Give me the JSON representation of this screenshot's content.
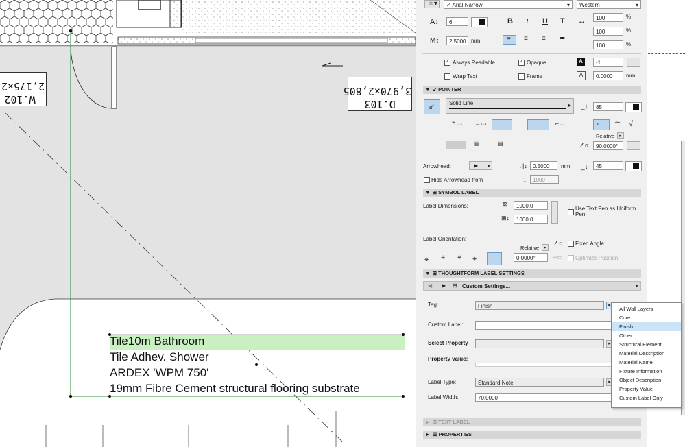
{
  "note": {
    "lines": [
      "Tile10m Bathroom",
      "Tile Adhev. Shower",
      "ARDEX 'WPM 750'",
      "19mm Fibre Cement structural flooring substrate"
    ],
    "highlight_color": "#c8f0c0"
  },
  "tags": {
    "window_tag": "W.102",
    "window_size": "2,175×2,",
    "door_tag": "D.103",
    "door_size": "3,970×2,805"
  },
  "panel": {
    "font_name": "Arial Narrow",
    "script": "Western",
    "text_size": "6",
    "spacing": "2.5000",
    "spacing_unit": "mm",
    "width_factor": "100",
    "char_spacing": "100",
    "slant": "100",
    "pct": "%",
    "always_readable": "Always Readable",
    "opaque": "Opaque",
    "wrap_text": "Wrap Text",
    "frame": "Frame",
    "bg_pen": "-1",
    "offset": "0.0000",
    "offset_unit": "mm",
    "pointer_section": "POINTER",
    "line_type": "Solid Line",
    "pointer_pen": "85",
    "relative": "Relative",
    "angle": "90.0000°",
    "arrowhead_label": "Arrowhead:",
    "arrow_size": "0.5000",
    "arrow_unit": "mm",
    "arrow_pen": "45",
    "hide_arrowhead": "Hide Arrowhead from",
    "scale_prefix": "1:",
    "scale_value": "1000",
    "symbol_section": "SYMBOL LABEL",
    "label_dimensions": "Label Dimensions:",
    "dim1": "1000.0",
    "dim2": "1000.0",
    "use_text_pen": "Use Text Pen as Uniform Pen",
    "label_orientation": "Label Orientation:",
    "relative2": "Relative",
    "orient_angle": "0.0000°",
    "fixed_angle": "Fixed Angle",
    "optimize_position": "Optimize Position",
    "thoughtform_section": "THOUGHTFORM LABEL SETTINGS",
    "custom_settings": "Custom Settings...",
    "tag_label": "Tag:",
    "tag_value": "Finish",
    "custom_label": "Custom Label:",
    "select_property": "Select Property",
    "property_value": "Property value:",
    "label_type_label": "Label Type:",
    "label_type_value": "Standard Note",
    "label_width_label": "Label Width:",
    "label_width_value": "70.0000",
    "text_label_section": "TEXT LABEL",
    "properties_section": "PROPERTIES"
  },
  "dropdown": {
    "items": [
      "All Wall Layers",
      "Core",
      "Finish",
      "Other",
      "Structural Element",
      "Material Description",
      "Material Name",
      "Fixture Information",
      "Object Description",
      "Property Value",
      "Custom Label Only"
    ],
    "selected": "Finish"
  }
}
